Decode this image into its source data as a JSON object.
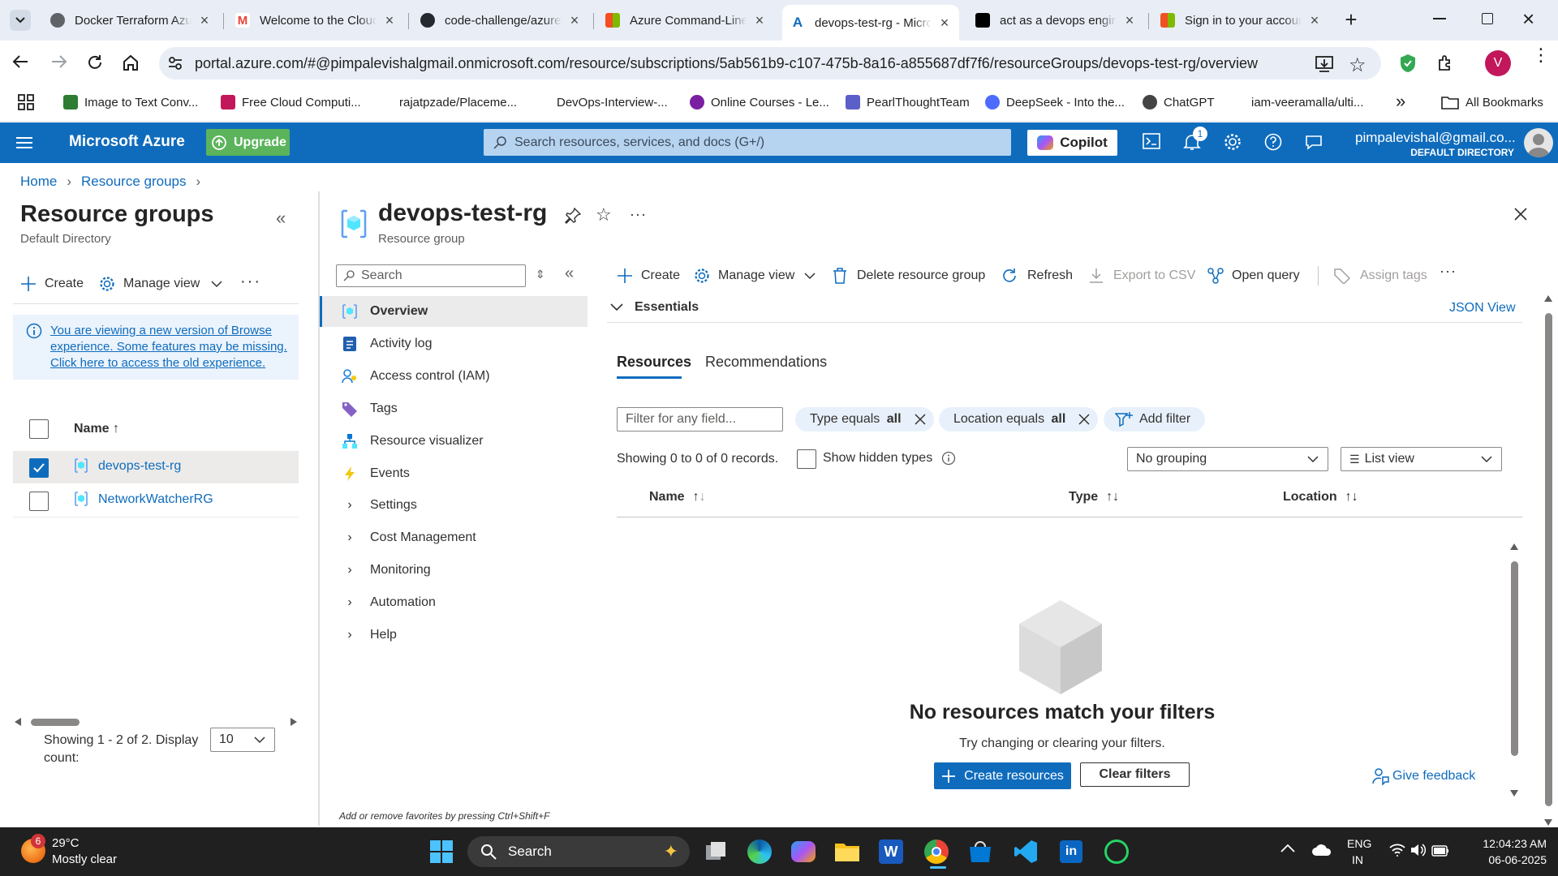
{
  "browser": {
    "tabs": [
      {
        "label": "Docker Terraform Azure",
        "icon": "docker-icon",
        "color": "#5f6368"
      },
      {
        "label": "Welcome to the Cloud",
        "icon": "gmail-icon",
        "color": "#ea4335"
      },
      {
        "label": "code-challenge/azure",
        "icon": "github-icon",
        "color": "#24292f"
      },
      {
        "label": "Azure Command-Line",
        "icon": "microsoft-icon",
        "color": "#f25022"
      },
      {
        "label": "devops-test-rg - Microsoft Azure",
        "icon": "azure-icon",
        "color": "#0f6cbd"
      },
      {
        "label": "act as a devops engineer",
        "icon": "chatgpt-icon",
        "color": "#000000"
      },
      {
        "label": "Sign in to your account",
        "icon": "microsoft-icon",
        "color": "#f25022"
      }
    ],
    "url": "portal.azure.com/#@pimpalevishalgmail.onmicrosoft.com/resource/subscriptions/5ab561b9-c107-475b-8a16-a855687df7f6/resourceGroups/devops-test-rg/overview",
    "profile_initial": "V",
    "bookmarks": [
      {
        "label": "Image to Text Conv...",
        "color": "#2e7d32"
      },
      {
        "label": "Free Cloud Computi...",
        "color": "#c2185b"
      },
      {
        "label": "rajatpzade/Placeme...",
        "color": "#24292f"
      },
      {
        "label": "DevOps-Interview-...",
        "color": "#24292f"
      },
      {
        "label": "Online Courses - Le...",
        "color": "#7b1fa2"
      },
      {
        "label": "PearlThoughtTeam",
        "color": "#5b5fc7"
      },
      {
        "label": "DeepSeek - Into the...",
        "color": "#4d6bfe"
      },
      {
        "label": "ChatGPT",
        "color": "#000000"
      },
      {
        "label": "iam-veeramalla/ulti...",
        "color": "#24292f"
      }
    ],
    "all_bookmarks": "All Bookmarks"
  },
  "azure_header": {
    "brand": "Microsoft Azure",
    "upgrade": "Upgrade",
    "search_placeholder": "Search resources, services, and docs (G+/)",
    "copilot": "Copilot",
    "notification_count": "1",
    "account_email": "pimpalevishal@gmail.co...",
    "account_directory": "DEFAULT DIRECTORY"
  },
  "breadcrumb": {
    "home": "Home",
    "resource_groups": "Resource groups"
  },
  "left_panel": {
    "title": "Resource groups",
    "subtitle": "Default Directory",
    "create": "Create",
    "manage_view": "Manage view",
    "info_text": "You are viewing a new version of Browse experience. Some features may be missing. Click here to access the old experience.",
    "name_header": "Name ↑",
    "rows": [
      {
        "name": "devops-test-rg",
        "checked": true
      },
      {
        "name": "NetworkWatcherRG",
        "checked": false
      }
    ],
    "footer_text": "Showing 1 - 2 of 2. Display count:",
    "display_count": "10"
  },
  "resource": {
    "title": "devops-test-rg",
    "subtitle": "Resource group",
    "menu_search_placeholder": "Search",
    "menu": [
      {
        "label": "Overview",
        "icon": "overview-icon"
      },
      {
        "label": "Activity log",
        "icon": "activity-log-icon"
      },
      {
        "label": "Access control (IAM)",
        "icon": "iam-icon"
      },
      {
        "label": "Tags",
        "icon": "tag-icon"
      },
      {
        "label": "Resource visualizer",
        "icon": "visualizer-icon"
      },
      {
        "label": "Events",
        "icon": "lightning-icon"
      }
    ],
    "menu_groups": [
      "Settings",
      "Cost Management",
      "Monitoring",
      "Automation",
      "Help"
    ],
    "favorites_hint": "Add or remove favorites by pressing Ctrl+Shift+F",
    "toolbar": {
      "create": "Create",
      "manage_view": "Manage view",
      "delete": "Delete resource group",
      "refresh": "Refresh",
      "export": "Export to CSV",
      "open_query": "Open query",
      "assign_tags": "Assign tags"
    },
    "essentials": "Essentials",
    "json_view": "JSON View",
    "tabs": [
      "Resources",
      "Recommendations"
    ],
    "filter_placeholder": "Filter for any field...",
    "filters": [
      {
        "label": "Type equals ",
        "value": "all"
      },
      {
        "label": "Location equals ",
        "value": "all"
      }
    ],
    "add_filter": "Add filter",
    "records_text": "Showing 0 to 0 of 0 records.",
    "show_hidden": "Show hidden types",
    "grouping": "No grouping",
    "view": "List view",
    "columns": [
      "Name",
      "Type",
      "Location"
    ],
    "empty_title": "No resources match your filters",
    "empty_sub": "Try changing or clearing your filters.",
    "create_resources": "Create resources",
    "clear_filters": "Clear filters",
    "give_feedback": "Give feedback"
  },
  "taskbar": {
    "weather_badge": "6",
    "temp": "29°C",
    "condition": "Mostly clear",
    "search": "Search",
    "lang1": "ENG",
    "lang2": "IN",
    "time": "12:04:23 AM",
    "date": "06-06-2025"
  }
}
